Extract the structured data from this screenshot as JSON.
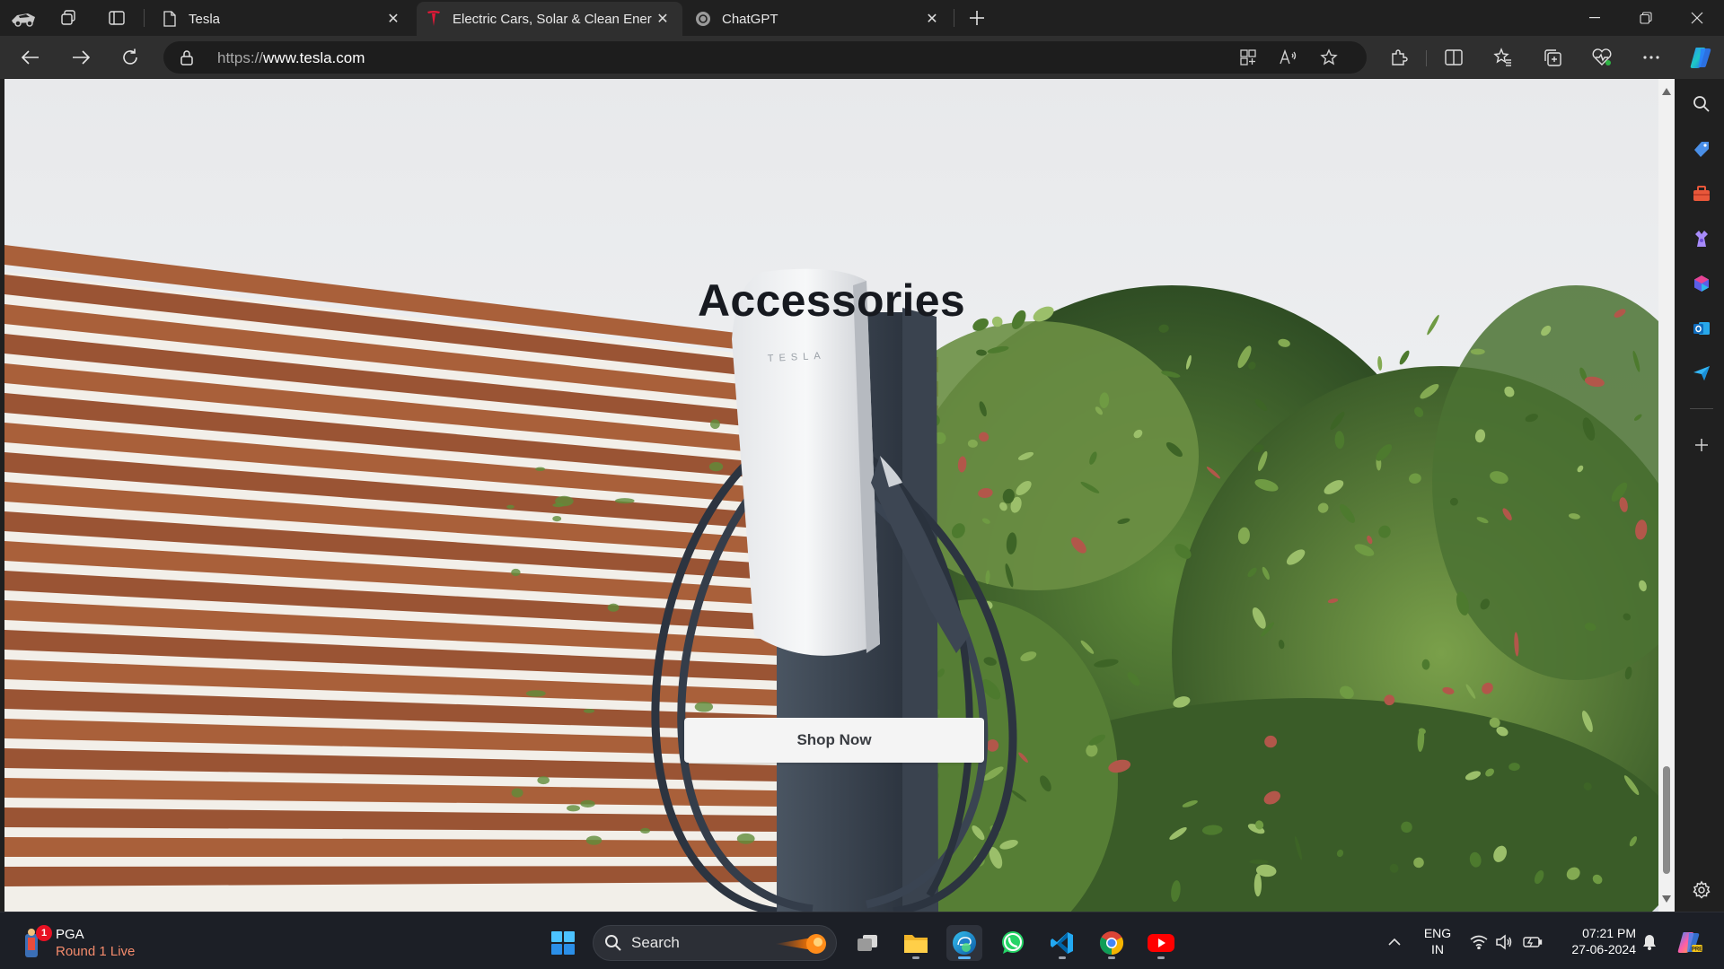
{
  "tabs": [
    {
      "title": "Tesla",
      "favicon": "page-icon"
    },
    {
      "title": "Electric Cars, Solar & Clean Energ",
      "favicon": "tesla-logo-icon",
      "active": true
    },
    {
      "title": "ChatGPT",
      "favicon": "chatgpt-icon"
    }
  ],
  "address_bar": {
    "protocol": "https://",
    "host": "www.tesla.com"
  },
  "page": {
    "heading": "Accessories",
    "cta_label": "Shop Now",
    "charger_brand": "TESLA"
  },
  "taskbar": {
    "widget": {
      "title": "PGA",
      "subtitle": "Round 1 Live",
      "badge": "1"
    },
    "search_label": "Search",
    "language": {
      "line1": "ENG",
      "line2": "IN"
    },
    "clock": {
      "time": "07:21 PM",
      "date": "27-06-2024"
    }
  },
  "colors": {
    "accent": "#e31937",
    "page_title": "#171a20",
    "chrome_dark": "#202020",
    "toolbar": "#2f2f2f"
  }
}
